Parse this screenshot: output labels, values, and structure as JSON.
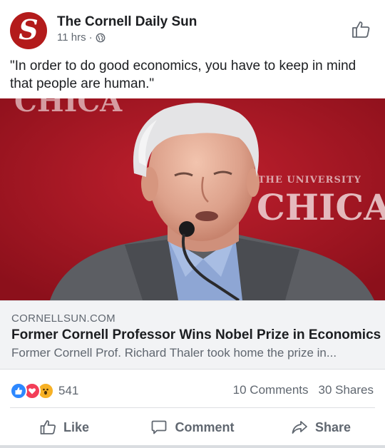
{
  "post": {
    "page_name": "The Cornell Daily Sun",
    "avatar_letter": "S",
    "time": "11 hrs",
    "separator": "·",
    "text": "\"In order to do good economics, you have to keep in mind that people are human.\""
  },
  "photo": {
    "banner_left": "CHICA",
    "banner_right_small": "THE UNIVERSITY",
    "banner_right_large": "CHICAG"
  },
  "link": {
    "domain": "CORNELLSUN.COM",
    "title": "Former Cornell Professor Wins Nobel Prize in Economics",
    "description": "Former Cornell Prof. Richard Thaler took home the prize in..."
  },
  "stats": {
    "reaction_count": "541",
    "comments": "10 Comments",
    "shares": "30 Shares"
  },
  "actions": {
    "like": "Like",
    "comment": "Comment",
    "share": "Share"
  },
  "colors": {
    "brand_red": "#b31b1b",
    "photo_bg": "#9e1420",
    "like_blue": "#2d88ff",
    "love_red": "#f33e58",
    "wow_yellow": "#f7b125"
  },
  "icons": [
    "globe-icon",
    "thumbs-up-icon",
    "like-reaction-icon",
    "love-reaction-icon",
    "wow-reaction-icon",
    "comment-icon",
    "share-icon"
  ]
}
